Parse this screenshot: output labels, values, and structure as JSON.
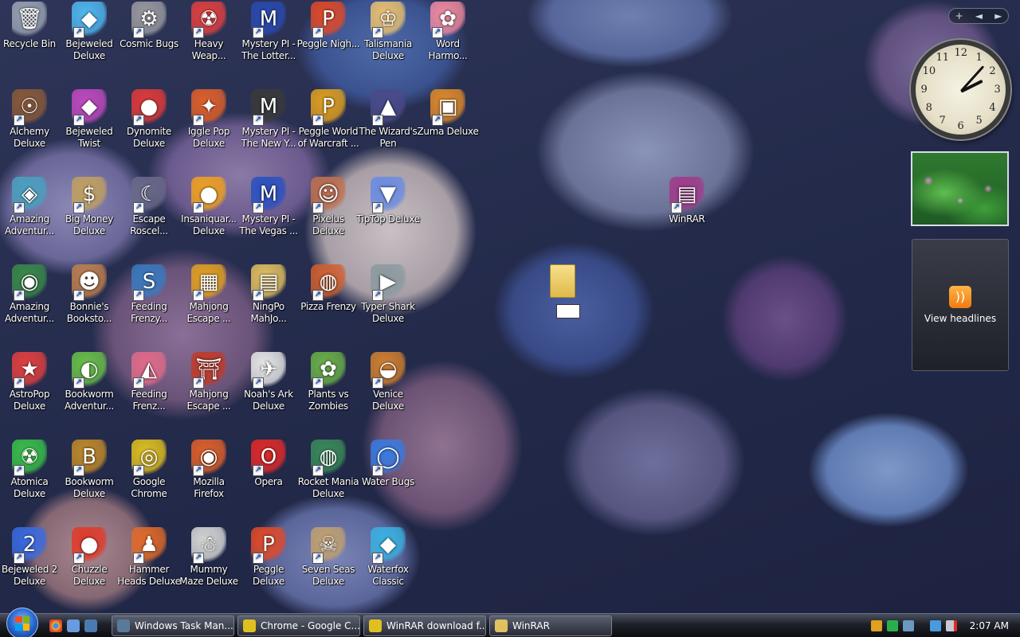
{
  "desktop": {
    "icons": [
      {
        "label": "Recycle Bin",
        "glyph": "🗑",
        "color": "#9aa4b4",
        "shortcut": false
      },
      {
        "label": "Bejeweled Deluxe",
        "glyph": "◆",
        "color": "#4fb8f0",
        "shortcut": true
      },
      {
        "label": "Cosmic Bugs",
        "glyph": "⚙",
        "color": "#9a9aa0",
        "shortcut": true
      },
      {
        "label": "Heavy Weap...",
        "glyph": "☢",
        "color": "#e04040",
        "shortcut": true
      },
      {
        "label": "Mystery PI - The Lotter...",
        "glyph": "M",
        "color": "#2a4ab0",
        "shortcut": true
      },
      {
        "label": "Peggle Nigh...",
        "glyph": "P",
        "color": "#e04a2a",
        "shortcut": true
      },
      {
        "label": "Talismania Deluxe",
        "glyph": "♔",
        "color": "#e8c070",
        "shortcut": true
      },
      {
        "label": "Word Harmo...",
        "glyph": "✿",
        "color": "#f08aa0",
        "shortcut": true
      },
      {
        "label": "Alchemy Deluxe",
        "glyph": "☉",
        "color": "#8a5a3a",
        "shortcut": true
      },
      {
        "label": "Bejeweled Twist",
        "glyph": "◆",
        "color": "#c04ac0",
        "shortcut": true
      },
      {
        "label": "Dynomite Deluxe",
        "glyph": "●",
        "color": "#e03a3a",
        "shortcut": true
      },
      {
        "label": "Iggle Pop Deluxe",
        "glyph": "✦",
        "color": "#e0602a",
        "shortcut": true
      },
      {
        "label": "Mystery PI - The New Y...",
        "glyph": "M",
        "color": "#3a3a3a",
        "shortcut": true
      },
      {
        "label": "Peggle World of Warcraft ...",
        "glyph": "P",
        "color": "#e0a020",
        "shortcut": true
      },
      {
        "label": "The Wizard's Pen",
        "glyph": "▲",
        "color": "#4a4a8a",
        "shortcut": true
      },
      {
        "label": "Zuma Deluxe",
        "glyph": "▣",
        "color": "#e08a2a",
        "shortcut": true
      },
      {
        "label": "Amazing Adventur...",
        "glyph": "◈",
        "color": "#4aa0c0",
        "shortcut": true
      },
      {
        "label": "Big Money Deluxe",
        "glyph": "$",
        "color": "#c0a060",
        "shortcut": true
      },
      {
        "label": "Escape Roscel...",
        "glyph": "☾",
        "color": "#6a6a8a",
        "shortcut": true
      },
      {
        "label": "Insaniquar... Deluxe",
        "glyph": "●",
        "color": "#f0a020",
        "shortcut": true
      },
      {
        "label": "Mystery PI - The Vegas ...",
        "glyph": "M",
        "color": "#2a50c0",
        "shortcut": true
      },
      {
        "label": "Pixelus Deluxe",
        "glyph": "☺",
        "color": "#c07050",
        "shortcut": true
      },
      {
        "label": "TipTop Deluxe",
        "glyph": "▼",
        "color": "#6a8ae0",
        "shortcut": true
      },
      {
        "label": "Amazing Adventur...",
        "glyph": "◉",
        "color": "#3a8a4a",
        "shortcut": true
      },
      {
        "label": "Bonnie's Booksto...",
        "glyph": "☻",
        "color": "#c08050",
        "shortcut": true
      },
      {
        "label": "Feeding Frenzy...",
        "glyph": "S",
        "color": "#3a7ac0",
        "shortcut": true
      },
      {
        "label": "Mahjong Escape ...",
        "glyph": "▦",
        "color": "#e0a020",
        "shortcut": true
      },
      {
        "label": "NingPo MahJo...",
        "glyph": "▤",
        "color": "#e0c060",
        "shortcut": true
      },
      {
        "label": "Pizza Frenzy",
        "glyph": "◍",
        "color": "#d06030",
        "shortcut": true
      },
      {
        "label": "Typer Shark Deluxe",
        "glyph": "▶",
        "color": "#8a9aa0",
        "shortcut": true
      },
      {
        "label": "AstroPop Deluxe",
        "glyph": "★",
        "color": "#e04040",
        "shortcut": true
      },
      {
        "label": "Bookworm Adventur...",
        "glyph": "◐",
        "color": "#6ac04a",
        "shortcut": true
      },
      {
        "label": "Feeding Frenz...",
        "glyph": "◭",
        "color": "#e06a8a",
        "shortcut": true
      },
      {
        "label": "Mahjong Escape ...",
        "glyph": "⛩",
        "color": "#c03a2a",
        "shortcut": true
      },
      {
        "label": "Noah's Ark Deluxe",
        "glyph": "✈",
        "color": "#e8e8e8",
        "shortcut": true
      },
      {
        "label": "Plants vs Zombies",
        "glyph": "✿",
        "color": "#6ab04a",
        "shortcut": true
      },
      {
        "label": "Venice Deluxe",
        "glyph": "◒",
        "color": "#d08030",
        "shortcut": true
      },
      {
        "label": "Atomica Deluxe",
        "glyph": "☢",
        "color": "#3ac04a",
        "shortcut": true
      },
      {
        "label": "Bookworm Deluxe",
        "glyph": "B",
        "color": "#c08a2a",
        "shortcut": true
      },
      {
        "label": "Google Chrome",
        "glyph": "◎",
        "color": "#e0c020",
        "shortcut": true
      },
      {
        "label": "Mozilla Firefox",
        "glyph": "◉",
        "color": "#e0602a",
        "shortcut": true
      },
      {
        "label": "Opera",
        "glyph": "O",
        "color": "#e02a2a",
        "shortcut": true
      },
      {
        "label": "Rocket Mania Deluxe",
        "glyph": "◍",
        "color": "#3a8a5a",
        "shortcut": true
      },
      {
        "label": "Water Bugs",
        "glyph": "◯",
        "color": "#3a7ae0",
        "shortcut": true
      },
      {
        "label": "Bejeweled 2 Deluxe",
        "glyph": "2",
        "color": "#3a6ae0",
        "shortcut": true
      },
      {
        "label": "Chuzzle Deluxe",
        "glyph": "●",
        "color": "#e03a2a",
        "shortcut": true
      },
      {
        "label": "Hammer Heads Deluxe",
        "glyph": "♟",
        "color": "#e06a2a",
        "shortcut": true
      },
      {
        "label": "Mummy Maze Deluxe",
        "glyph": "☃",
        "color": "#d8d8d8",
        "shortcut": true
      },
      {
        "label": "Peggle Deluxe",
        "glyph": "P",
        "color": "#e04a2a",
        "shortcut": true
      },
      {
        "label": "Seven Seas Deluxe",
        "glyph": "☠",
        "color": "#c0a070",
        "shortcut": true
      },
      {
        "label": "Waterfox Classic",
        "glyph": "◆",
        "color": "#3ab0e0",
        "shortcut": true
      },
      {
        "label": "WinRAR",
        "glyph": "▤",
        "color": "#a03a8a",
        "shortcut": true
      }
    ],
    "rename_field": {
      "value": ""
    }
  },
  "sidebar": {
    "controls": [
      "+",
      "◄",
      "►"
    ],
    "clock": {
      "numbers": [
        "12",
        "1",
        "2",
        "3",
        "4",
        "5",
        "6",
        "7",
        "8",
        "9",
        "10",
        "11"
      ],
      "hour": 2,
      "minute": 7
    },
    "feed": {
      "label": "View headlines"
    }
  },
  "taskbar": {
    "buttons": [
      {
        "label": "Windows Task Man...",
        "color": "#5a7a9a"
      },
      {
        "label": "Chrome - Google C...",
        "color": "#e0c020"
      },
      {
        "label": "WinRAR download f...",
        "color": "#e0c020"
      },
      {
        "label": "WinRAR",
        "color": "#e0c060"
      }
    ],
    "time": "2:07 AM"
  }
}
